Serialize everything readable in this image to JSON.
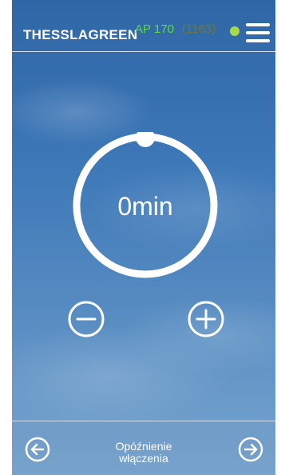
{
  "header": {
    "brand": "THESSLAGREEN",
    "model": "AP 170",
    "serial": "(1163)",
    "status_color": "#a8d94a",
    "menu_icon": "hamburger-menu-icon"
  },
  "dial": {
    "value": "0min",
    "progress_fraction": 0
  },
  "controls": {
    "decrease_icon": "minus-circle-icon",
    "increase_icon": "plus-circle-icon"
  },
  "footer": {
    "label_line1": "Opóźnienie",
    "label_line2": "włączenia",
    "prev_icon": "arrow-left-circle-icon",
    "next_icon": "arrow-right-circle-icon"
  },
  "colors": {
    "accent_green": "#5ddc3a",
    "serial_text": "#6d7a3e",
    "foreground": "#ffffff"
  }
}
